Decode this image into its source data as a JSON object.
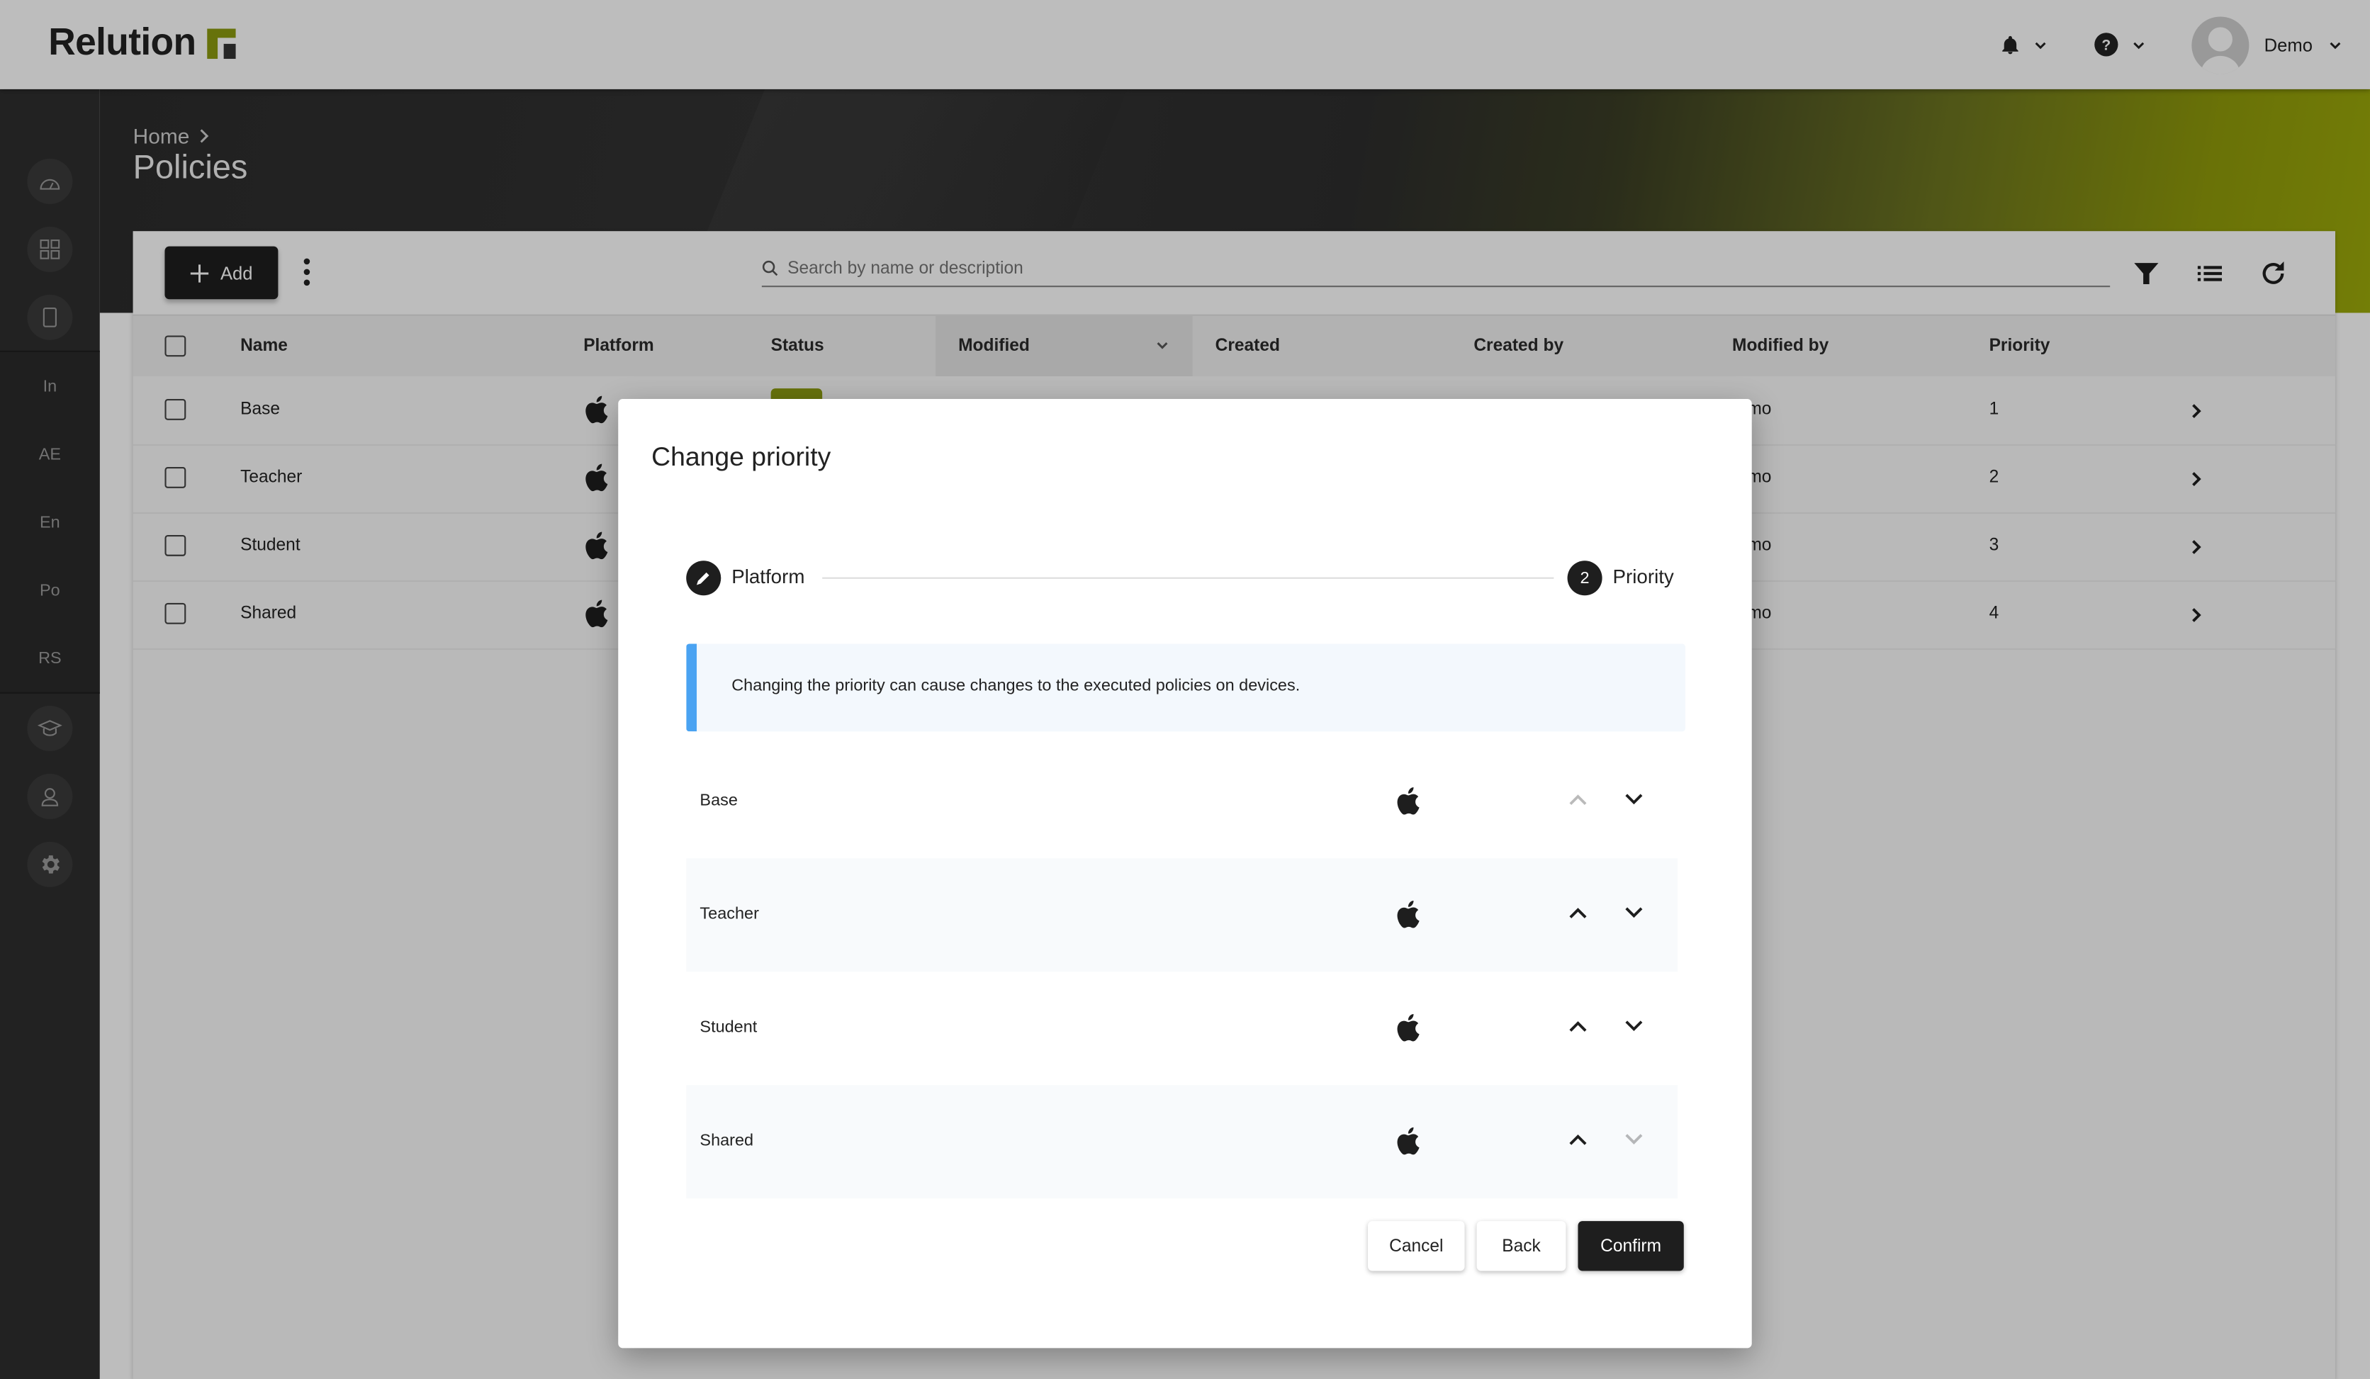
{
  "app": {
    "brand": "Relution",
    "colors": {
      "accent": "#8c9a10",
      "primary_dark": "#1e1e1e",
      "info_border": "#4aa3f2",
      "info_bg": "#f3f8fd"
    }
  },
  "topbar": {
    "notifications_icon": "bell-icon",
    "help_icon": "help-icon",
    "user": {
      "name": "Demo",
      "avatar_icon": "user-avatar-icon"
    }
  },
  "sidebar": {
    "items": [
      {
        "type": "icon",
        "icon": "dashboard-icon"
      },
      {
        "type": "icon",
        "icon": "apps-grid-icon"
      },
      {
        "type": "icon",
        "icon": "device-icon"
      },
      {
        "type": "text",
        "label": "In"
      },
      {
        "type": "text",
        "label": "AE"
      },
      {
        "type": "text",
        "label": "En"
      },
      {
        "type": "text",
        "label": "Po"
      },
      {
        "type": "text",
        "label": "RS"
      },
      {
        "type": "icon",
        "icon": "graduation-cap-icon"
      },
      {
        "type": "icon",
        "icon": "user-icon"
      },
      {
        "type": "icon",
        "icon": "gear-icon"
      }
    ]
  },
  "header": {
    "breadcrumb": [
      "Home"
    ],
    "title": "Policies"
  },
  "toolbar": {
    "add_label": "Add",
    "search_placeholder": "Search by name or description",
    "search_value": ""
  },
  "table": {
    "columns": [
      "Name",
      "Platform",
      "Status",
      "Modified",
      "Created",
      "Created by",
      "Modified by",
      "Priority"
    ],
    "sorted_column": "Modified",
    "rows": [
      {
        "name": "Base",
        "platform": "apple",
        "modified_by": "mo",
        "priority": "1"
      },
      {
        "name": "Teacher",
        "platform": "apple",
        "modified_by": "mo",
        "priority": "2"
      },
      {
        "name": "Student",
        "platform": "apple",
        "modified_by": "mo",
        "priority": "3"
      },
      {
        "name": "Shared",
        "platform": "apple",
        "modified_by": "mo",
        "priority": "4"
      }
    ]
  },
  "dialog": {
    "title": "Change priority",
    "steps": [
      {
        "label": "Platform",
        "state": "done",
        "marker": "edit"
      },
      {
        "label": "Priority",
        "state": "active",
        "marker": "2"
      }
    ],
    "info": "Changing the priority can cause changes to the executed policies on devices.",
    "items": [
      {
        "name": "Base",
        "platform": "apple",
        "up_enabled": false,
        "down_enabled": true
      },
      {
        "name": "Teacher",
        "platform": "apple",
        "up_enabled": true,
        "down_enabled": true
      },
      {
        "name": "Student",
        "platform": "apple",
        "up_enabled": true,
        "down_enabled": true
      },
      {
        "name": "Shared",
        "platform": "apple",
        "up_enabled": true,
        "down_enabled": false
      }
    ],
    "buttons": {
      "cancel": "Cancel",
      "back": "Back",
      "confirm": "Confirm"
    }
  }
}
